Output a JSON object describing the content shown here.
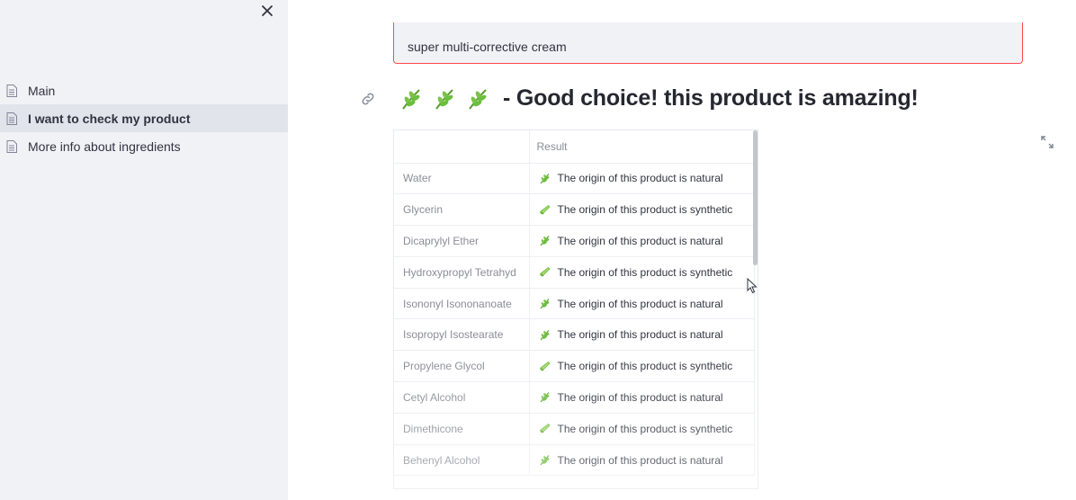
{
  "sidebar": {
    "close_icon": "close-icon",
    "items": [
      {
        "label": "Main",
        "icon": "document-icon",
        "active": false
      },
      {
        "label": "I want to check my product",
        "icon": "document-icon",
        "active": true
      },
      {
        "label": "More info about ingredients",
        "icon": "document-icon",
        "active": false
      }
    ]
  },
  "main": {
    "product_input": {
      "value": "super multi-corrective cream"
    },
    "heading": {
      "icons": [
        "herb-icon",
        "herb-icon",
        "herb-icon"
      ],
      "text": "- Good choice! this product is amazing!"
    },
    "table": {
      "columns": [
        "",
        "Result"
      ],
      "rows": [
        {
          "ingredient": "Water",
          "result": "The origin of this product is natural",
          "icon": "herb-icon"
        },
        {
          "ingredient": "Glycerin",
          "result": "The origin of this product is synthetic",
          "icon": "test-tube-icon"
        },
        {
          "ingredient": "Dicaprylyl Ether",
          "result": "The origin of this product is natural",
          "icon": "herb-icon"
        },
        {
          "ingredient": "Hydroxypropyl Tetrahyd",
          "result": "The origin of this product is synthetic",
          "icon": "test-tube-icon"
        },
        {
          "ingredient": "Isononyl Isononanoate",
          "result": "The origin of this product is natural",
          "icon": "herb-icon"
        },
        {
          "ingredient": "Isopropyl Isostearate",
          "result": "The origin of this product is natural",
          "icon": "herb-icon"
        },
        {
          "ingredient": "Propylene Glycol",
          "result": "The origin of this product is synthetic",
          "icon": "test-tube-icon"
        },
        {
          "ingredient": "Cetyl Alcohol",
          "result": "The origin of this product is natural",
          "icon": "herb-icon"
        },
        {
          "ingredient": "Dimethicone",
          "result": "The origin of this product is synthetic",
          "icon": "test-tube-icon"
        },
        {
          "ingredient": "Behenyl Alcohol",
          "result": "The origin of this product is natural",
          "icon": "herb-icon"
        }
      ]
    }
  },
  "colors": {
    "accent_red": "#ff4b4b",
    "sidebar_bg": "#f0f2f6",
    "herb_green": "#6abf3c"
  }
}
